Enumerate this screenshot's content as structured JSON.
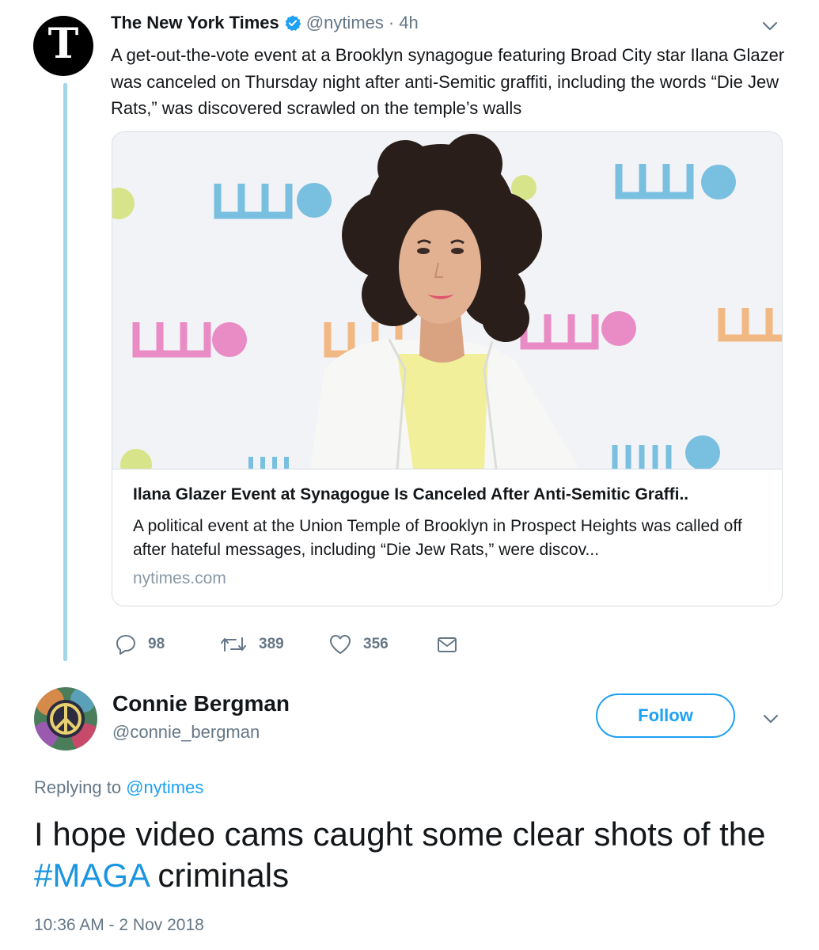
{
  "quoted_tweet": {
    "author_name": "The New York Times",
    "author_handle": "@nytimes",
    "separator": "·",
    "time_ago": "4h",
    "avatar_letter": "T",
    "text": "A get-out-the-vote event at a Brooklyn synagogue featuring Broad City star Ilana Glazer was canceled on Thursday night after anti-Semitic graffiti, including the words “Die Jew Rats,” was discovered scrawled on the temple’s walls",
    "card": {
      "title": "Ilana Glazer Event at Synagogue Is Canceled After Anti-Semitic Graffi..",
      "description": "A political event at the Union Temple of Brooklyn in Prospect Heights was called off after hateful messages, including “Die Jew Rats,” were discov...",
      "domain": "nytimes.com"
    },
    "actions": {
      "replies": "98",
      "retweets": "389",
      "likes": "356"
    }
  },
  "reply_tweet": {
    "author_name": "Connie Bergman",
    "author_handle": "@connie_bergman",
    "follow_label": "Follow",
    "replying_prefix": "Replying to",
    "replying_to": "@nytimes",
    "text_before": "I hope video cams caught some clear shots of the ",
    "hashtag": "#MAGA",
    "text_after": " criminals",
    "timestamp": "10:36 AM - 2 Nov 2018"
  },
  "colors": {
    "link_blue": "#1da1f2",
    "muted_gray": "#657786",
    "thread_line": "#a3d5e8"
  }
}
